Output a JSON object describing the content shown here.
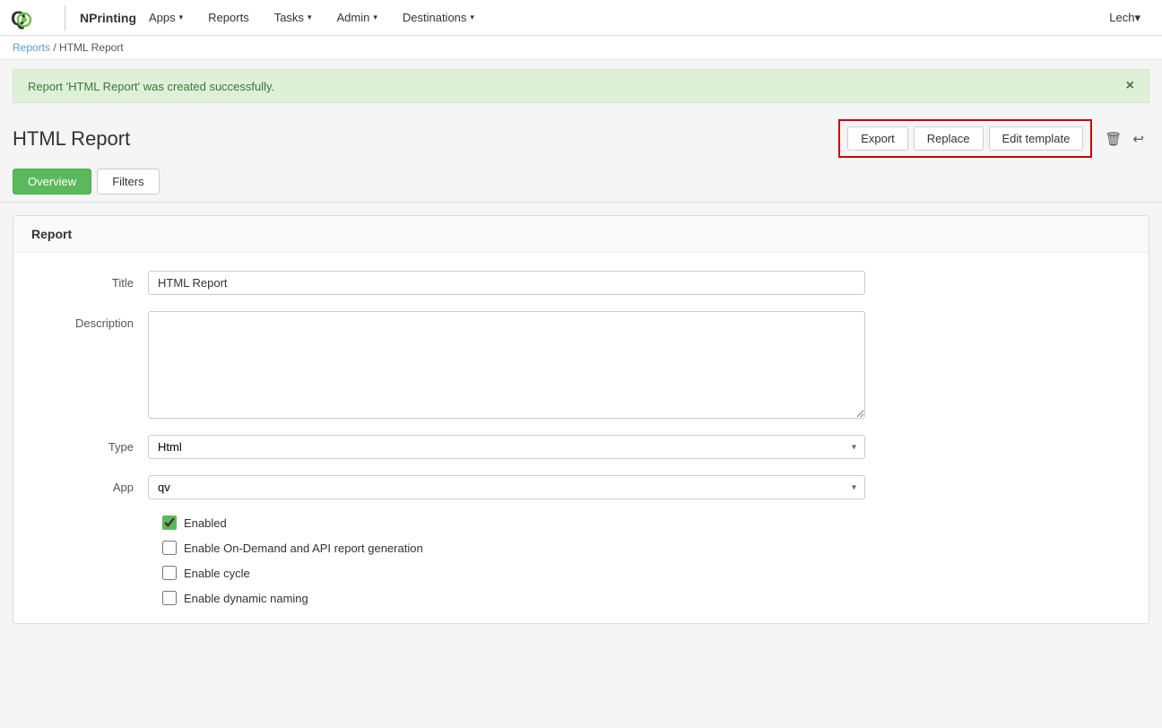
{
  "navbar": {
    "brand": "NPrinting",
    "user": "Lech",
    "nav_items": [
      {
        "label": "Apps",
        "has_dropdown": true
      },
      {
        "label": "Reports",
        "has_dropdown": false
      },
      {
        "label": "Tasks",
        "has_dropdown": true
      },
      {
        "label": "Admin",
        "has_dropdown": true
      },
      {
        "label": "Destinations",
        "has_dropdown": true
      }
    ]
  },
  "breadcrumb": {
    "parent_label": "Reports",
    "separator": "/",
    "current": "HTML Report"
  },
  "alert": {
    "message": "Report 'HTML Report' was created successfully.",
    "close_label": "×"
  },
  "page": {
    "title": "HTML Report",
    "buttons": {
      "export": "Export",
      "replace": "Replace",
      "edit_template": "Edit template"
    }
  },
  "tabs": [
    {
      "label": "Overview",
      "active": true
    },
    {
      "label": "Filters",
      "active": false
    }
  ],
  "form": {
    "section_title": "Report",
    "fields": {
      "title_label": "Title",
      "title_value": "HTML Report",
      "description_label": "Description",
      "description_placeholder": "",
      "type_label": "Type",
      "type_value": "Html",
      "app_label": "App",
      "app_value": "qv"
    },
    "checkboxes": [
      {
        "label": "Enabled",
        "checked": true
      },
      {
        "label": "Enable On-Demand and API report generation",
        "checked": false
      },
      {
        "label": "Enable cycle",
        "checked": false
      },
      {
        "label": "Enable dynamic naming",
        "checked": false
      }
    ]
  }
}
